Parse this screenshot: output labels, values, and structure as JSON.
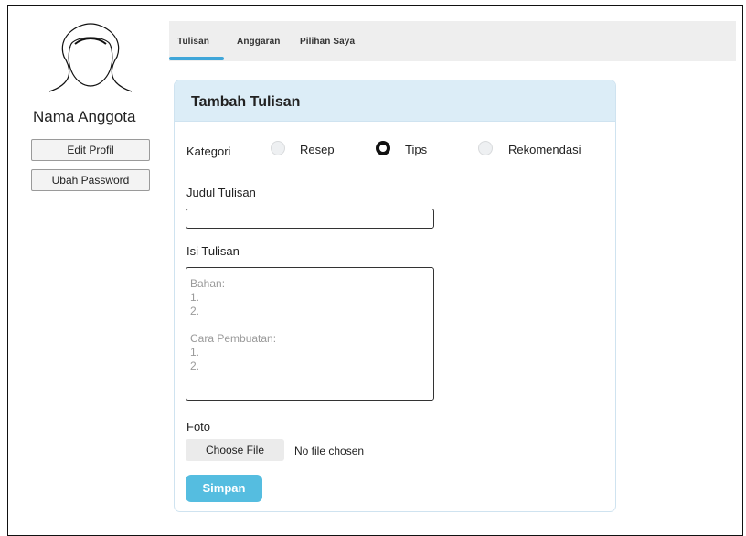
{
  "profile": {
    "name": "Nama Anggota",
    "edit_profile_label": "Edit Profil",
    "change_password_label": "Ubah Password"
  },
  "tabs": [
    {
      "label": "Tulisan",
      "active": true
    },
    {
      "label": "Anggaran",
      "active": false
    },
    {
      "label": "Pilihan Saya",
      "active": false
    }
  ],
  "form": {
    "title": "Tambah Tulisan",
    "category_label": "Kategori",
    "categories": [
      {
        "label": "Resep",
        "selected": false
      },
      {
        "label": "Tips",
        "selected": true
      },
      {
        "label": "Rekomendasi",
        "selected": false
      }
    ],
    "title_label": "Judul Tulisan",
    "title_value": "",
    "content_label": "Isi Tulisan",
    "content_placeholder": "Bahan:\n1.\n2.\n\nCara Pembuatan:\n1.\n2.",
    "photo_label": "Foto",
    "choose_file_label": "Choose File",
    "file_status": "No file chosen",
    "save_label": "Simpan"
  },
  "colors": {
    "accent": "#55bde0",
    "tab_underline": "#3fa6d9",
    "card_header": "#dcedf7",
    "tabbar_bg": "#eeeeee"
  }
}
